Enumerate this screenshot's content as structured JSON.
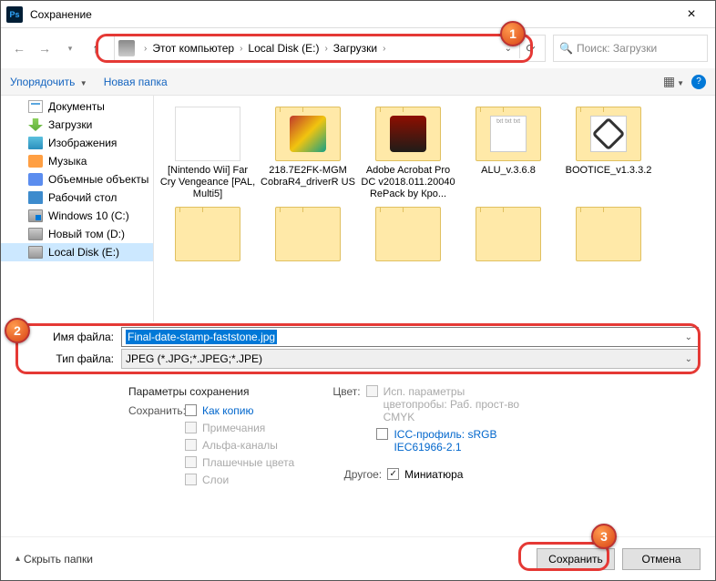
{
  "window": {
    "title": "Сохранение"
  },
  "breadcrumb": {
    "items": [
      "Этот компьютер",
      "Local Disk (E:)",
      "Загрузки"
    ]
  },
  "search": {
    "placeholder": "Поиск: Загрузки"
  },
  "toolbar": {
    "organize": "Упорядочить",
    "new_folder": "Новая папка"
  },
  "sidebar": {
    "items": [
      {
        "label": "Документы"
      },
      {
        "label": "Загрузки"
      },
      {
        "label": "Изображения"
      },
      {
        "label": "Музыка"
      },
      {
        "label": "Объемные объекты"
      },
      {
        "label": "Рабочий стол"
      },
      {
        "label": "Windows 10 (C:)"
      },
      {
        "label": "Новый том (D:)"
      },
      {
        "label": "Local Disk (E:)"
      }
    ]
  },
  "files": [
    {
      "name": "[Nintendo Wii] Far Cry Vengeance [PAL, Multi5]"
    },
    {
      "name": "218.7E2FK-MGM CobraR4_driverR US"
    },
    {
      "name": "Adobe Acrobat Pro DC v2018.011.20040 RePack by Кро..."
    },
    {
      "name": "ALU_v.3.6.8"
    },
    {
      "name": "BOOTICE_v1.3.3.2"
    }
  ],
  "fields": {
    "filename_label": "Имя файла:",
    "filename_value": "Final-date-stamp-faststone.jpg",
    "filetype_label": "Тип файла:",
    "filetype_value": "JPEG (*.JPG;*.JPEG;*.JPE)"
  },
  "save_options": {
    "header": "Параметры сохранения",
    "save_label": "Сохранить:",
    "as_copy": "Как копию",
    "notes": "Примечания",
    "alpha": "Альфа-каналы",
    "spot": "Плашечные цвета",
    "layers": "Слои",
    "color_label": "Цвет:",
    "proof": "Исп. параметры цветопробы: Раб. прост-во CMYK",
    "icc": "ICC-профиль: sRGB IEC61966-2.1",
    "other_label": "Другое:",
    "thumbnail": "Миниатюра"
  },
  "footer": {
    "hide_folders": "Скрыть папки",
    "save": "Сохранить",
    "cancel": "Отмена"
  },
  "callouts": {
    "b1": "1",
    "b2": "2",
    "b3": "3"
  }
}
